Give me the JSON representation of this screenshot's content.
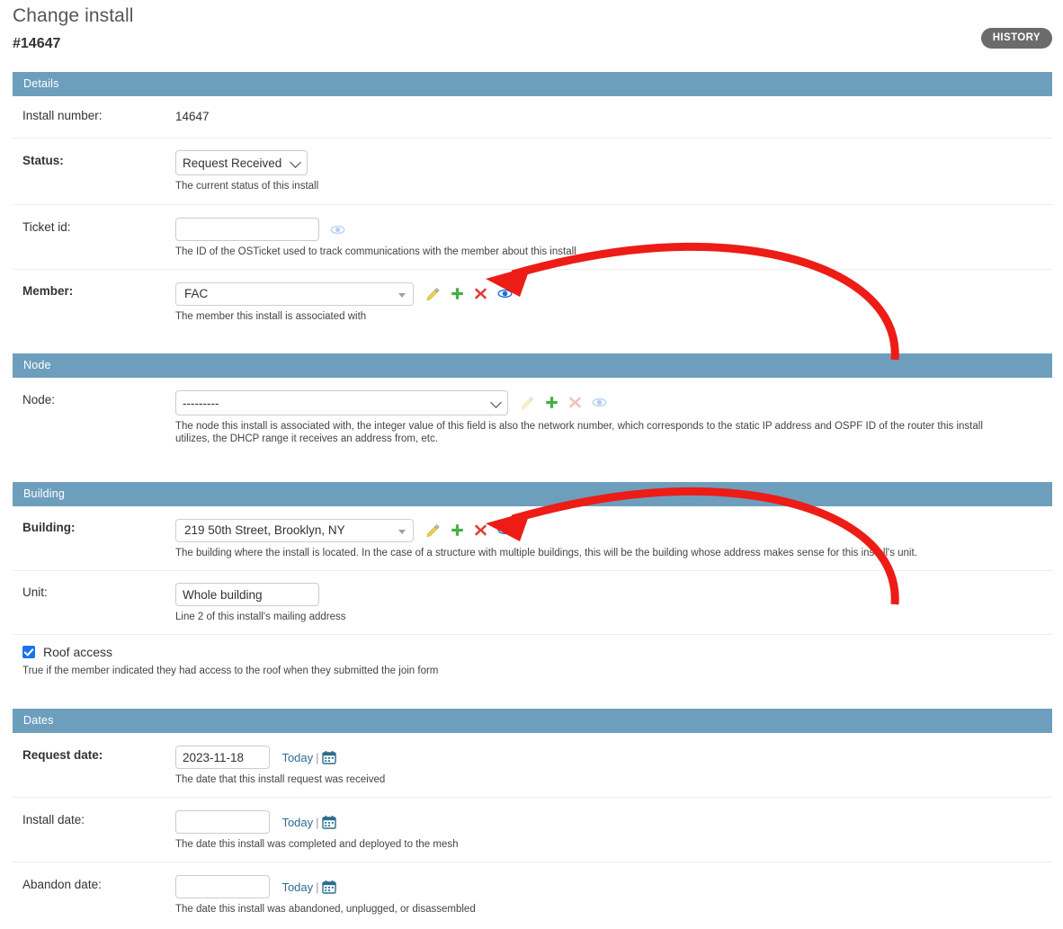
{
  "header": {
    "title": "Change install",
    "object_id": "#14647",
    "history_label": "HISTORY"
  },
  "colors": {
    "fieldset_header_bg": "#6d9fbd",
    "history_bg": "#6b6b6b",
    "checkbox_blue": "#1a73e8",
    "link_blue": "#2b6d8f",
    "arrow_red": "#ed1c16",
    "icon_pencil": "#efd358",
    "icon_add": "#44b149",
    "icon_delete": "#e03a34",
    "icon_view": "#1e6fd9"
  },
  "fieldsets": [
    {
      "name": "details",
      "title": "Details",
      "rows": [
        {
          "name": "install-number",
          "label": "Install number:",
          "label_bold": false,
          "type": "readonly",
          "value": "14647",
          "help": ""
        },
        {
          "name": "status",
          "label": "Status:",
          "label_bold": true,
          "type": "select",
          "value": "Request Received",
          "help": "The current status of this install"
        },
        {
          "name": "ticket-id",
          "label": "Ticket id:",
          "label_bold": false,
          "type": "text",
          "value": "",
          "placeholder": "",
          "help": "The ID of the OSTicket used to track communications with the member about this install"
        },
        {
          "name": "member",
          "label": "Member:",
          "label_bold": true,
          "type": "select2",
          "value": "FAC",
          "help": "The member this install is associated with",
          "actions_enabled": true
        }
      ]
    },
    {
      "name": "node",
      "title": "Node",
      "rows": [
        {
          "name": "node",
          "label": "Node:",
          "label_bold": false,
          "type": "select-wide",
          "value": "---------",
          "help": "The node this install is associated with, the integer value of this field is also the network number, which corresponds to the static IP address and OSPF ID of the router this install utilizes, the DHCP range it receives an address from, etc.",
          "actions_enabled": false
        }
      ]
    },
    {
      "name": "building",
      "title": "Building",
      "rows": [
        {
          "name": "building",
          "label": "Building:",
          "label_bold": true,
          "type": "select2",
          "value": "219 50th Street, Brooklyn, NY",
          "help": "The building where the install is located. In the case of a structure with multiple buildings, this will be the building whose address makes sense for this install's unit.",
          "actions_enabled": true
        },
        {
          "name": "unit",
          "label": "Unit:",
          "label_bold": false,
          "type": "text",
          "value": "Whole building",
          "placeholder": "",
          "help": "Line 2 of this install's mailing address"
        },
        {
          "name": "roof-access",
          "label": "Roof access",
          "label_bold": false,
          "type": "checkbox",
          "checked": true,
          "help": "True if the member indicated they had access to the roof when they submitted the join form"
        }
      ]
    },
    {
      "name": "dates",
      "title": "Dates",
      "rows": [
        {
          "name": "request-date",
          "label": "Request date:",
          "label_bold": true,
          "type": "date",
          "value": "2023-11-18",
          "today_label": "Today",
          "help": "The date that this install request was received"
        },
        {
          "name": "install-date",
          "label": "Install date:",
          "label_bold": false,
          "type": "date",
          "value": "",
          "today_label": "Today",
          "help": "The date this install was completed and deployed to the mesh"
        },
        {
          "name": "abandon-date",
          "label": "Abandon date:",
          "label_bold": false,
          "type": "date",
          "value": "",
          "today_label": "Today",
          "help": "The date this install was abandoned, unplugged, or disassembled"
        }
      ]
    }
  ],
  "icons": {
    "pencil": "pencil-icon",
    "add": "add-icon",
    "delete": "delete-icon",
    "view": "view-icon",
    "calendar": "calendar-icon",
    "chevron": "chevron-down-icon"
  },
  "annotations": [
    {
      "name": "arrow-to-member-view-icon",
      "target": "member view icon"
    },
    {
      "name": "arrow-to-building-view-icon",
      "target": "building view icon"
    }
  ]
}
